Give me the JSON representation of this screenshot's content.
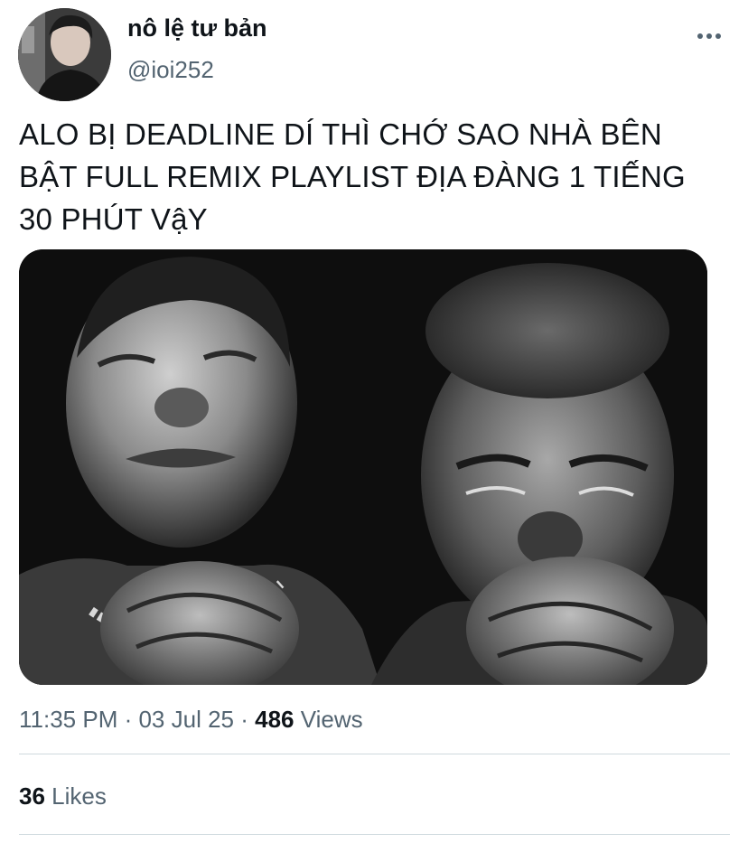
{
  "author": {
    "display_name": "nô lệ tư bản",
    "handle": "@ioi252",
    "avatar_icon": "profile-photo"
  },
  "more_icon": "more-horizontal-icon",
  "tweet": {
    "lines": [
      "ALO BỊ DEADLINE DÍ THÌ CHỚ SAO NHÀ BÊN",
      "BẬT FULL REMIX PLAYLIST ĐỊA ĐÀNG 1 TIẾNG",
      "30 PHÚT VậY"
    ]
  },
  "meta": {
    "time": "11:35 PM",
    "sep1": " · ",
    "date": "03 Jul 25",
    "sep2": " · ",
    "views_count": "486",
    "views_label": " Views"
  },
  "stats": {
    "likes_count": "36",
    "likes_label": " Likes"
  },
  "colors": {
    "text_primary": "#0f1419",
    "text_secondary": "#536471",
    "divider": "#cfd9de",
    "background": "#ffffff"
  }
}
